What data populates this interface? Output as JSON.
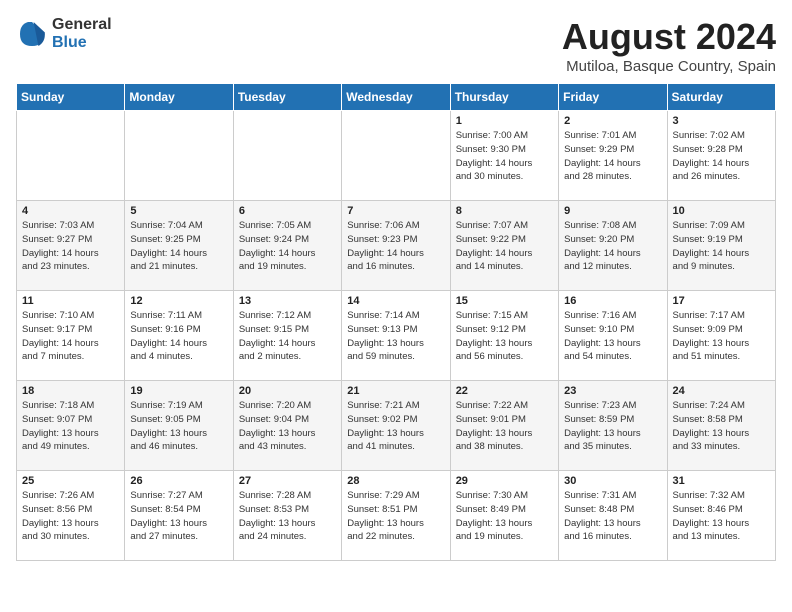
{
  "logo": {
    "general": "General",
    "blue": "Blue"
  },
  "title": "August 2024",
  "subtitle": "Mutiloa, Basque Country, Spain",
  "days_of_week": [
    "Sunday",
    "Monday",
    "Tuesday",
    "Wednesday",
    "Thursday",
    "Friday",
    "Saturday"
  ],
  "weeks": [
    [
      {
        "num": "",
        "detail": ""
      },
      {
        "num": "",
        "detail": ""
      },
      {
        "num": "",
        "detail": ""
      },
      {
        "num": "",
        "detail": ""
      },
      {
        "num": "1",
        "detail": "Sunrise: 7:00 AM\nSunset: 9:30 PM\nDaylight: 14 hours\nand 30 minutes."
      },
      {
        "num": "2",
        "detail": "Sunrise: 7:01 AM\nSunset: 9:29 PM\nDaylight: 14 hours\nand 28 minutes."
      },
      {
        "num": "3",
        "detail": "Sunrise: 7:02 AM\nSunset: 9:28 PM\nDaylight: 14 hours\nand 26 minutes."
      }
    ],
    [
      {
        "num": "4",
        "detail": "Sunrise: 7:03 AM\nSunset: 9:27 PM\nDaylight: 14 hours\nand 23 minutes."
      },
      {
        "num": "5",
        "detail": "Sunrise: 7:04 AM\nSunset: 9:25 PM\nDaylight: 14 hours\nand 21 minutes."
      },
      {
        "num": "6",
        "detail": "Sunrise: 7:05 AM\nSunset: 9:24 PM\nDaylight: 14 hours\nand 19 minutes."
      },
      {
        "num": "7",
        "detail": "Sunrise: 7:06 AM\nSunset: 9:23 PM\nDaylight: 14 hours\nand 16 minutes."
      },
      {
        "num": "8",
        "detail": "Sunrise: 7:07 AM\nSunset: 9:22 PM\nDaylight: 14 hours\nand 14 minutes."
      },
      {
        "num": "9",
        "detail": "Sunrise: 7:08 AM\nSunset: 9:20 PM\nDaylight: 14 hours\nand 12 minutes."
      },
      {
        "num": "10",
        "detail": "Sunrise: 7:09 AM\nSunset: 9:19 PM\nDaylight: 14 hours\nand 9 minutes."
      }
    ],
    [
      {
        "num": "11",
        "detail": "Sunrise: 7:10 AM\nSunset: 9:17 PM\nDaylight: 14 hours\nand 7 minutes."
      },
      {
        "num": "12",
        "detail": "Sunrise: 7:11 AM\nSunset: 9:16 PM\nDaylight: 14 hours\nand 4 minutes."
      },
      {
        "num": "13",
        "detail": "Sunrise: 7:12 AM\nSunset: 9:15 PM\nDaylight: 14 hours\nand 2 minutes."
      },
      {
        "num": "14",
        "detail": "Sunrise: 7:14 AM\nSunset: 9:13 PM\nDaylight: 13 hours\nand 59 minutes."
      },
      {
        "num": "15",
        "detail": "Sunrise: 7:15 AM\nSunset: 9:12 PM\nDaylight: 13 hours\nand 56 minutes."
      },
      {
        "num": "16",
        "detail": "Sunrise: 7:16 AM\nSunset: 9:10 PM\nDaylight: 13 hours\nand 54 minutes."
      },
      {
        "num": "17",
        "detail": "Sunrise: 7:17 AM\nSunset: 9:09 PM\nDaylight: 13 hours\nand 51 minutes."
      }
    ],
    [
      {
        "num": "18",
        "detail": "Sunrise: 7:18 AM\nSunset: 9:07 PM\nDaylight: 13 hours\nand 49 minutes."
      },
      {
        "num": "19",
        "detail": "Sunrise: 7:19 AM\nSunset: 9:05 PM\nDaylight: 13 hours\nand 46 minutes."
      },
      {
        "num": "20",
        "detail": "Sunrise: 7:20 AM\nSunset: 9:04 PM\nDaylight: 13 hours\nand 43 minutes."
      },
      {
        "num": "21",
        "detail": "Sunrise: 7:21 AM\nSunset: 9:02 PM\nDaylight: 13 hours\nand 41 minutes."
      },
      {
        "num": "22",
        "detail": "Sunrise: 7:22 AM\nSunset: 9:01 PM\nDaylight: 13 hours\nand 38 minutes."
      },
      {
        "num": "23",
        "detail": "Sunrise: 7:23 AM\nSunset: 8:59 PM\nDaylight: 13 hours\nand 35 minutes."
      },
      {
        "num": "24",
        "detail": "Sunrise: 7:24 AM\nSunset: 8:58 PM\nDaylight: 13 hours\nand 33 minutes."
      }
    ],
    [
      {
        "num": "25",
        "detail": "Sunrise: 7:26 AM\nSunset: 8:56 PM\nDaylight: 13 hours\nand 30 minutes."
      },
      {
        "num": "26",
        "detail": "Sunrise: 7:27 AM\nSunset: 8:54 PM\nDaylight: 13 hours\nand 27 minutes."
      },
      {
        "num": "27",
        "detail": "Sunrise: 7:28 AM\nSunset: 8:53 PM\nDaylight: 13 hours\nand 24 minutes."
      },
      {
        "num": "28",
        "detail": "Sunrise: 7:29 AM\nSunset: 8:51 PM\nDaylight: 13 hours\nand 22 minutes."
      },
      {
        "num": "29",
        "detail": "Sunrise: 7:30 AM\nSunset: 8:49 PM\nDaylight: 13 hours\nand 19 minutes."
      },
      {
        "num": "30",
        "detail": "Sunrise: 7:31 AM\nSunset: 8:48 PM\nDaylight: 13 hours\nand 16 minutes."
      },
      {
        "num": "31",
        "detail": "Sunrise: 7:32 AM\nSunset: 8:46 PM\nDaylight: 13 hours\nand 13 minutes."
      }
    ]
  ]
}
